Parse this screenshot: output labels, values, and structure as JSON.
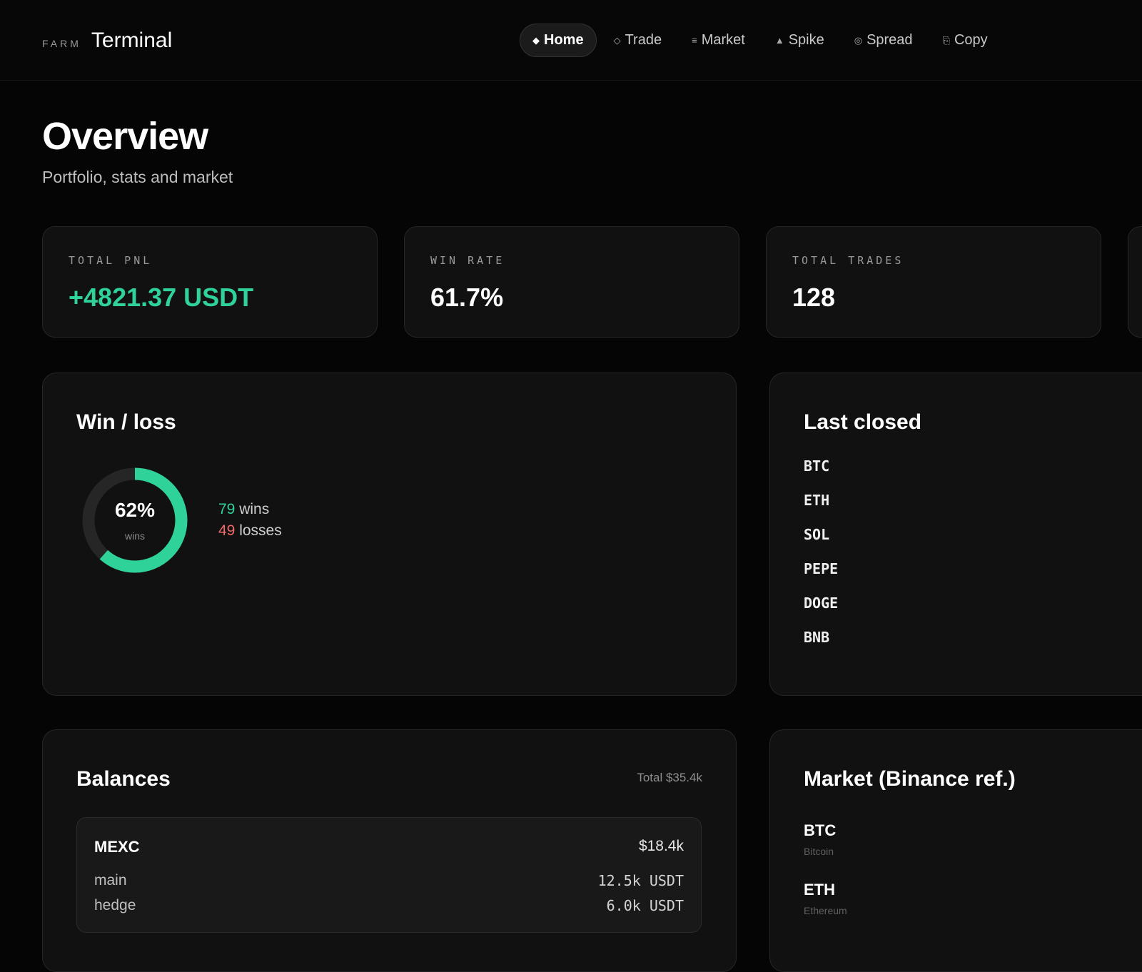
{
  "brand": {
    "small": "FARM",
    "big": "Terminal"
  },
  "nav": [
    {
      "glyph": "◆",
      "icon": "home-diamond-icon",
      "label": "Home",
      "active": true
    },
    {
      "glyph": "◇",
      "icon": "trade-diamond-icon",
      "label": "Trade"
    },
    {
      "glyph": "≡",
      "icon": "market-lines-icon",
      "label": "Market"
    },
    {
      "glyph": "▲",
      "icon": "spike-triangle-icon",
      "label": "Spike"
    },
    {
      "glyph": "◎",
      "icon": "spread-target-icon",
      "label": "Spread"
    },
    {
      "glyph": "⎘",
      "icon": "copy-icon",
      "label": "Copy"
    }
  ],
  "header": {
    "title": "Overview",
    "subtitle": "Portfolio, stats and market"
  },
  "stats": [
    {
      "label": "TOTAL PNL",
      "value": "+4821.37 USDT"
    },
    {
      "label": "WIN RATE",
      "value": "61.7%"
    },
    {
      "label": "TOTAL TRADES",
      "value": "128"
    }
  ],
  "winloss": {
    "title": "Win / loss",
    "percent_label": "62%",
    "caption": "wins",
    "wins": "79",
    "wins_label": "wins",
    "losses": "49",
    "losses_label": "losses",
    "win_fraction": 0.617,
    "colors": {
      "win": "#2fd39a",
      "track": "#262626"
    }
  },
  "last_closed": {
    "title": "Last closed",
    "items": [
      "BTC",
      "ETH",
      "SOL",
      "PEPE",
      "DOGE",
      "BNB"
    ]
  },
  "balances": {
    "title": "Balances",
    "total": "Total $35.4k",
    "accounts": [
      {
        "name": "MEXC",
        "total": "$18.4k",
        "rows": [
          {
            "label": "main",
            "amount": "12.5k USDT"
          },
          {
            "label": "hedge",
            "amount": "6.0k USDT"
          }
        ]
      }
    ]
  },
  "market": {
    "title": "Market (Binance ref.)",
    "items": [
      {
        "symbol": "BTC",
        "name": "Bitcoin"
      },
      {
        "symbol": "ETH",
        "name": "Ethereum"
      }
    ]
  },
  "colors": {
    "accent_green": "#2fd39a",
    "loss_red": "#f06b6b",
    "background": "#050505",
    "card": "#111111"
  }
}
